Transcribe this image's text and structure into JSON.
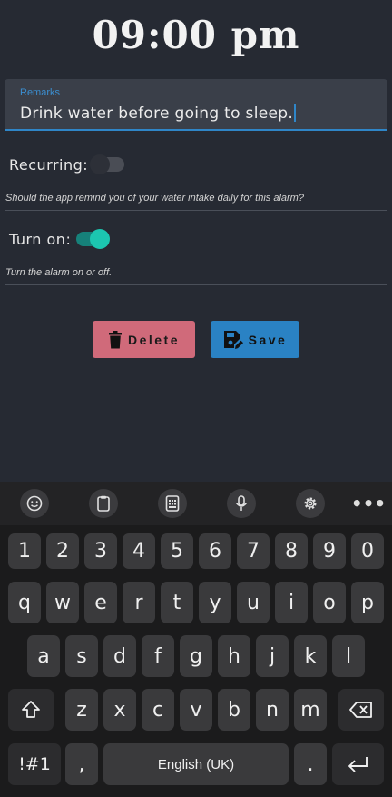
{
  "header": {
    "time": "09:00 pm"
  },
  "remarks": {
    "label": "Remarks",
    "value": "Drink water before going to sleep."
  },
  "recurring": {
    "label": "Recurring:",
    "enabled": false,
    "hint": "Should the app remind you of your water intake daily for this alarm?"
  },
  "turn_on": {
    "label": "Turn on:",
    "enabled": true,
    "hint": "Turn the alarm on or off."
  },
  "actions": {
    "delete_label": "Delete",
    "save_label": "Save"
  },
  "colors": {
    "background": "#262a33",
    "accent_blue": "#2f86c8",
    "delete_bg": "#d06a7a",
    "save_bg": "#2a82c4",
    "toggle_on": "#1cc6b0"
  },
  "keyboard": {
    "toolbar_icons": [
      "emoji-icon",
      "clipboard-icon",
      "keyboard-layout-icon",
      "microphone-icon",
      "settings-icon",
      "more-icon"
    ],
    "more_label": "•••",
    "row_numbers": [
      "1",
      "2",
      "3",
      "4",
      "5",
      "6",
      "7",
      "8",
      "9",
      "0"
    ],
    "row1": [
      "q",
      "w",
      "e",
      "r",
      "t",
      "y",
      "u",
      "i",
      "o",
      "p"
    ],
    "row2": [
      "a",
      "s",
      "d",
      "f",
      "g",
      "h",
      "j",
      "k",
      "l"
    ],
    "row3": [
      "z",
      "x",
      "c",
      "v",
      "b",
      "n",
      "m"
    ],
    "symbols_label": "!#1",
    "comma_label": ",",
    "space_label": "English (UK)",
    "period_label": "."
  }
}
